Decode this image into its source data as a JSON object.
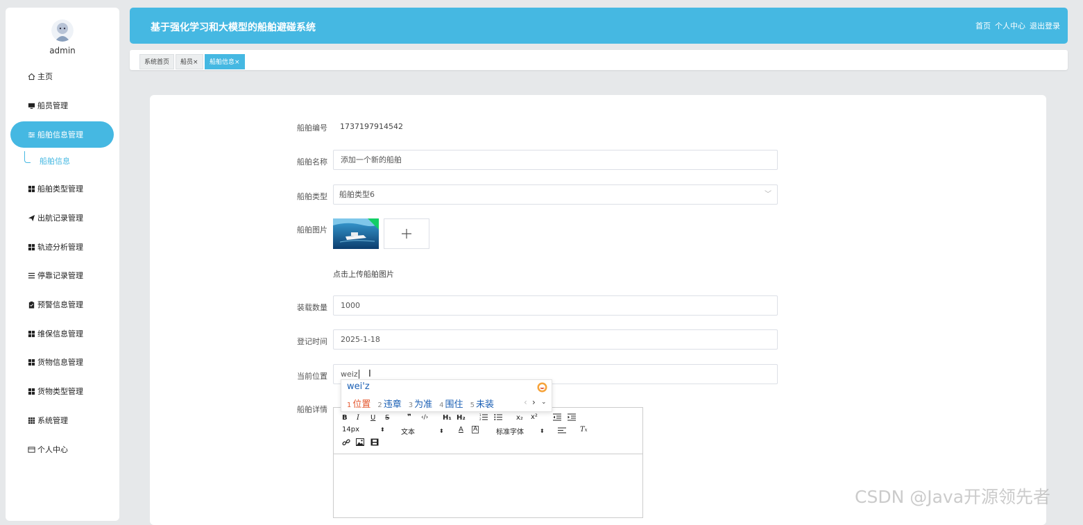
{
  "user": {
    "name": "admin"
  },
  "header": {
    "title": "基于强化学习和大模型的船舶避碰系统",
    "links": [
      "首页",
      "个人中心",
      "退出登录"
    ]
  },
  "sidebar": {
    "items": [
      {
        "label": "主页",
        "icon": "home-icon"
      },
      {
        "label": "船员管理",
        "icon": "monitor-icon"
      },
      {
        "label": "船舶信息管理",
        "icon": "sliders-icon",
        "active": true
      },
      {
        "label": "船舶类型管理",
        "icon": "grid-icon"
      },
      {
        "label": "出航记录管理",
        "icon": "send-icon"
      },
      {
        "label": "轨迹分析管理",
        "icon": "grid-icon"
      },
      {
        "label": "停靠记录管理",
        "icon": "list-icon"
      },
      {
        "label": "预警信息管理",
        "icon": "clipboard-icon"
      },
      {
        "label": "维保信息管理",
        "icon": "grid-icon"
      },
      {
        "label": "货物信息管理",
        "icon": "grid-icon"
      },
      {
        "label": "货物类型管理",
        "icon": "grid-icon"
      },
      {
        "label": "系统管理",
        "icon": "apps-icon"
      },
      {
        "label": "个人中心",
        "icon": "card-icon"
      }
    ],
    "sub_item": "船舶信息"
  },
  "tabs": [
    {
      "label": "系统首页"
    },
    {
      "label": "船员",
      "close": "×"
    },
    {
      "label": "船舶信息",
      "close": "×",
      "active": true
    }
  ],
  "form": {
    "ship_no": {
      "label": "船舶编号",
      "value": "1737197914542"
    },
    "ship_name": {
      "label": "船舶名称",
      "value": "添加一个新的船舶"
    },
    "ship_type": {
      "label": "船舶类型",
      "value": "船舶类型6"
    },
    "ship_image": {
      "label": "船舶图片",
      "tip": "点击上传船舶图片"
    },
    "capacity": {
      "label": "装载数量",
      "value": "1000"
    },
    "register_time": {
      "label": "登记时间",
      "value": "2025-1-18"
    },
    "position": {
      "label": "当前位置",
      "value": "weiz"
    },
    "details": {
      "label": "船舶详情"
    }
  },
  "editor": {
    "font_size": "14px",
    "text_type": "文本",
    "font_family": "标准字体"
  },
  "ime": {
    "composition": "wei'z",
    "candidates": [
      {
        "num": "1",
        "text": "位置"
      },
      {
        "num": "2",
        "text": "违章"
      },
      {
        "num": "3",
        "text": "为准"
      },
      {
        "num": "4",
        "text": "围住"
      },
      {
        "num": "5",
        "text": "未装"
      }
    ]
  },
  "watermark": "CSDN @Java开源领先者",
  "colors": {
    "accent": "#45b8e2",
    "success": "#13ce66",
    "ime_first": "#e4572e"
  }
}
